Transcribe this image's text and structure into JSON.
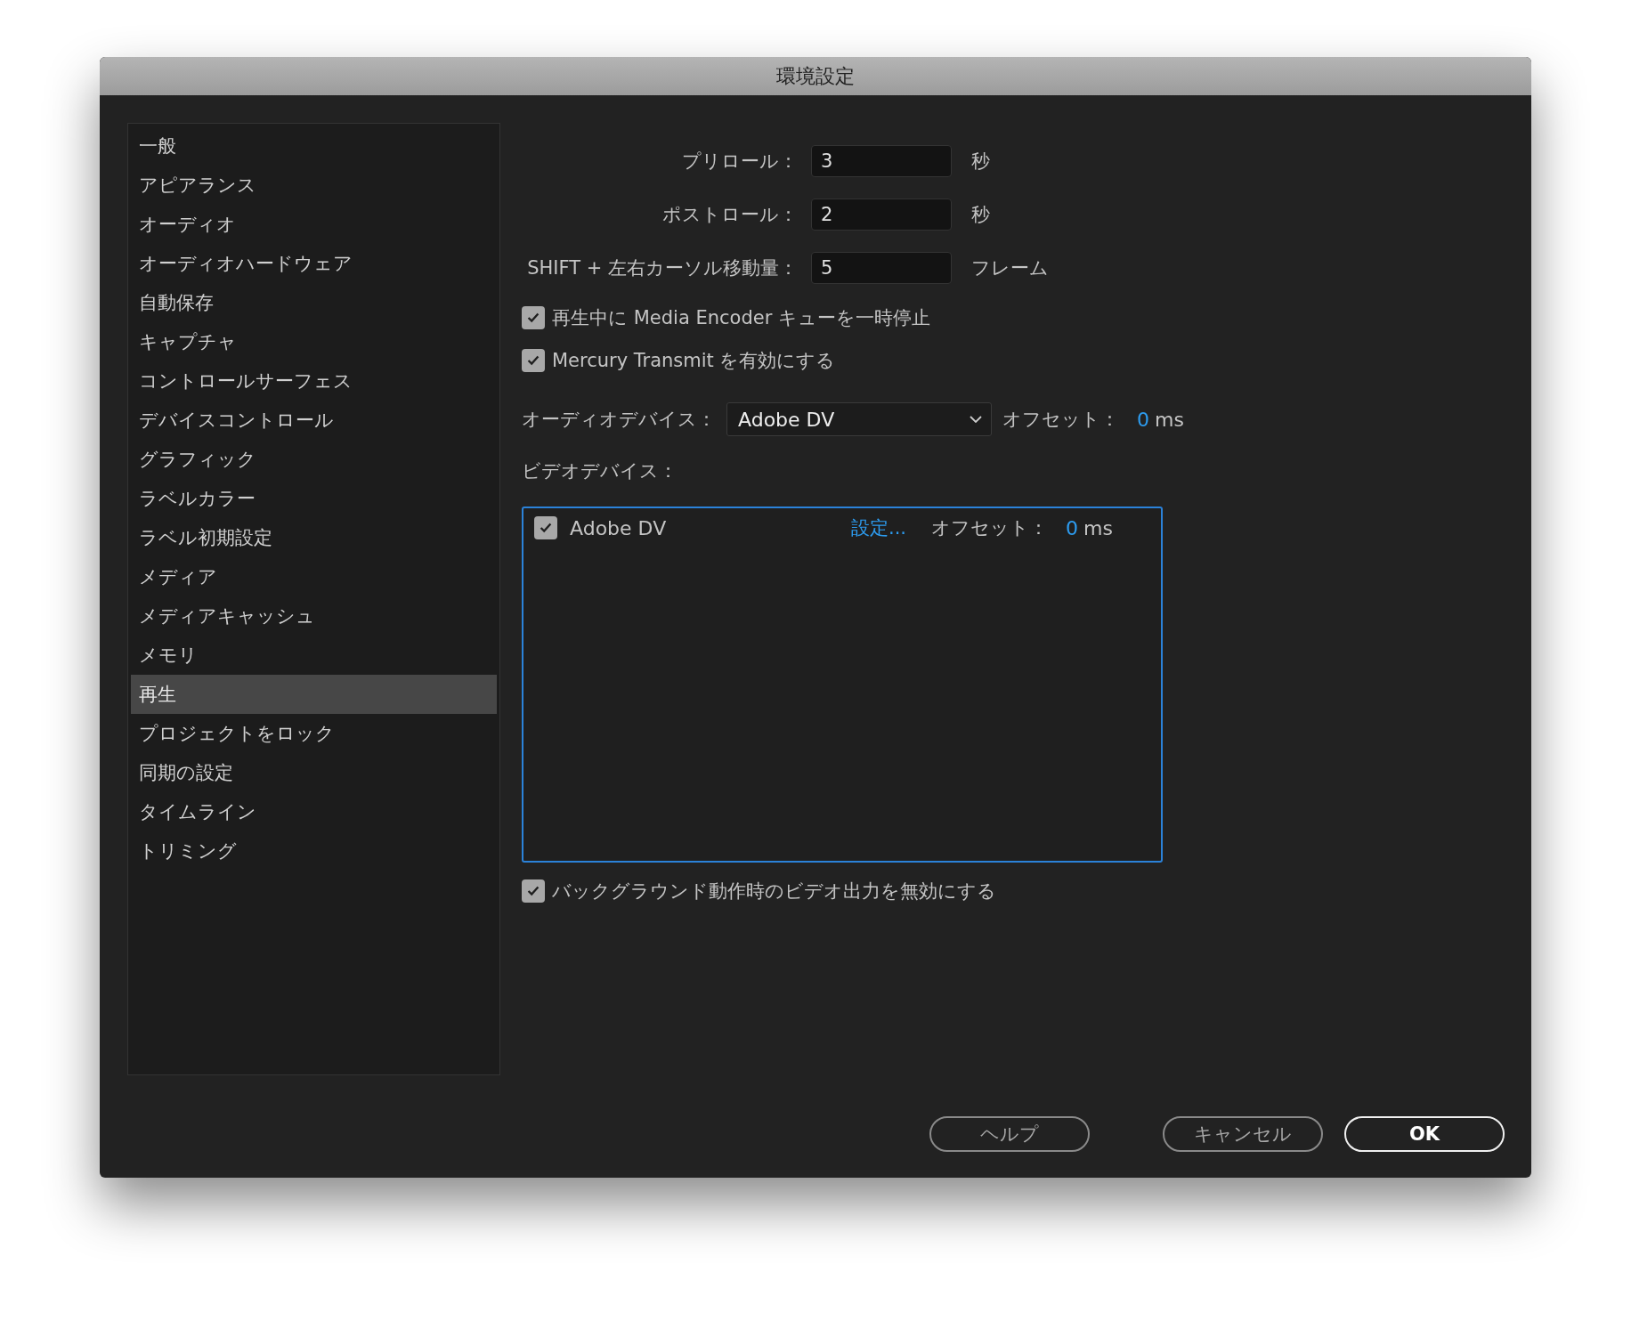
{
  "window": {
    "title": "環境設定"
  },
  "sidebar": {
    "items": [
      {
        "label": "一般",
        "selected": false
      },
      {
        "label": "アピアランス",
        "selected": false
      },
      {
        "label": "オーディオ",
        "selected": false
      },
      {
        "label": "オーディオハードウェア",
        "selected": false
      },
      {
        "label": "自動保存",
        "selected": false
      },
      {
        "label": "キャプチャ",
        "selected": false
      },
      {
        "label": "コントロールサーフェス",
        "selected": false
      },
      {
        "label": "デバイスコントロール",
        "selected": false
      },
      {
        "label": "グラフィック",
        "selected": false
      },
      {
        "label": "ラベルカラー",
        "selected": false
      },
      {
        "label": "ラベル初期設定",
        "selected": false
      },
      {
        "label": "メディア",
        "selected": false
      },
      {
        "label": "メディアキャッシュ",
        "selected": false
      },
      {
        "label": "メモリ",
        "selected": false
      },
      {
        "label": "再生",
        "selected": true
      },
      {
        "label": "プロジェクトをロック",
        "selected": false
      },
      {
        "label": "同期の設定",
        "selected": false
      },
      {
        "label": "タイムライン",
        "selected": false
      },
      {
        "label": "トリミング",
        "selected": false
      }
    ]
  },
  "fields": [
    {
      "label": "プリロール：",
      "value": "3",
      "unit": "秒"
    },
    {
      "label": "ポストロール：",
      "value": "2",
      "unit": "秒"
    },
    {
      "label": "SHIFT + 左右カーソル移動量：",
      "value": "5",
      "unit": "フレーム"
    }
  ],
  "options": [
    {
      "label": "再生中に Media Encoder キューを一時停止",
      "checked": true
    },
    {
      "label": "Mercury Transmit を有効にする",
      "checked": true
    }
  ],
  "audio_device": {
    "label": "オーディオデバイス：",
    "value": "Adobe DV",
    "offset_label": "オフセット：",
    "offset_value": "0",
    "offset_unit": "ms"
  },
  "video_devices": {
    "label": "ビデオデバイス：",
    "items": [
      {
        "name": "Adobe DV",
        "checked": true,
        "settings_link": "設定...",
        "offset_label": "オフセット：",
        "offset_value": "0",
        "offset_unit": "ms"
      }
    ]
  },
  "background_option": {
    "label": "バックグラウンド動作時のビデオ出力を無効にする",
    "checked": true
  },
  "buttons": [
    {
      "label": "ヘルプ",
      "kind": "normal"
    },
    {
      "label": "キャンセル",
      "kind": "normal"
    },
    {
      "label": "OK",
      "kind": "default"
    }
  ]
}
